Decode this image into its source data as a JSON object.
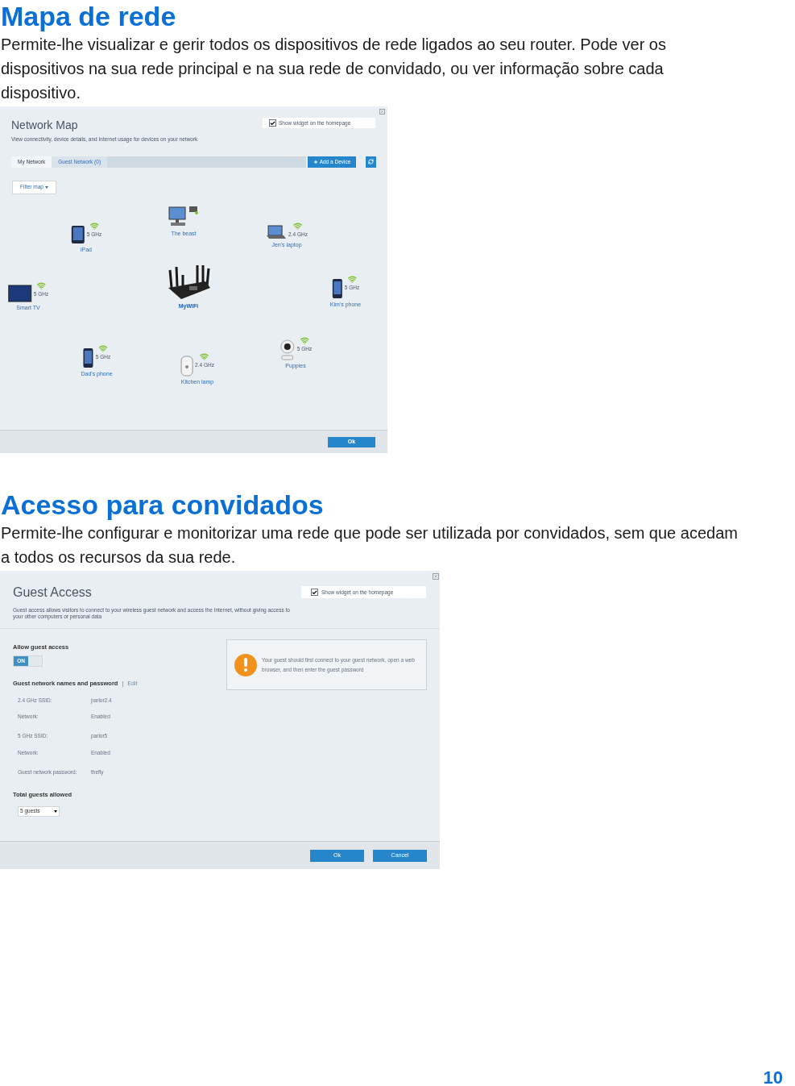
{
  "sections": [
    {
      "heading": "Mapa de rede",
      "text": "Permite-lhe visualizar e gerir todos os dispositivos de rede ligados ao seu router. Pode ver os dispositivos na sua rede principal e na sua rede de convidado, ou ver informação sobre cada dispositivo."
    },
    {
      "heading": "Acesso para convidados",
      "text": "Permite-lhe configurar e monitorizar uma rede que pode ser utilizada por convidados, sem que acedam a todos os recursos da sua rede."
    }
  ],
  "network_map": {
    "title": "Network Map",
    "subtitle": "View connectivity, device details, and Internet usage for devices on your network",
    "widget": {
      "label": "Show widget on the homepage",
      "checked": true
    },
    "tabs": [
      {
        "label": "My Network",
        "selected": true
      },
      {
        "label": "Guest Network (0)",
        "selected": false
      }
    ],
    "add_button": "Add a Device",
    "filter": "Filter map",
    "devices": [
      {
        "kind": "tablet",
        "name": "iPad",
        "band": "5 GHz"
      },
      {
        "kind": "desktop",
        "name": "The beast"
      },
      {
        "kind": "laptop",
        "name": "Jen's laptop",
        "band": "2.4 GHz"
      },
      {
        "kind": "tv",
        "name": "Smart TV",
        "band": "5 GHz"
      },
      {
        "kind": "router",
        "name": "MyWiFi"
      },
      {
        "kind": "phone",
        "name": "Kim's phone",
        "band": "5 GHz"
      },
      {
        "kind": "phone",
        "name": "Dad's phone",
        "band": "5 GHz"
      },
      {
        "kind": "lamp",
        "name": "Kitchen lamp",
        "band": "2.4 GHz"
      },
      {
        "kind": "camera",
        "name": "Puppies",
        "band": "5 GHz"
      }
    ],
    "ok_button": "Ok"
  },
  "guest_access": {
    "title": "Guest Access",
    "subtitle": "Guest access allows visitors to connect to your wireless guest network and access the Internet, without giving access to your other computers or personal data",
    "widget": {
      "label": "Show widget on the homepage",
      "checked": true
    },
    "allow_label": "Allow guest access",
    "toggle": {
      "label": "ON",
      "on": true
    },
    "names_heading": "Guest network names and password",
    "separator": "|",
    "edit_link": "Edit",
    "fields": [
      {
        "label": "2.4 GHz SSID:",
        "value": "parlor2.4"
      },
      {
        "label": "Network:",
        "value": "Enabled"
      },
      {
        "label": "5 GHz SSID:",
        "value": "parlor5"
      },
      {
        "label": "Network:",
        "value": "Enabled"
      },
      {
        "label": "Guest network password:",
        "value": "thefly"
      }
    ],
    "total_label": "Total guests allowed",
    "total_select": "5 guests",
    "notice": "Your guest should first connect to your guest network, open a web browser, and then enter the guest password",
    "buttons": [
      "Ok",
      "Cancel"
    ]
  },
  "page_number": "10"
}
